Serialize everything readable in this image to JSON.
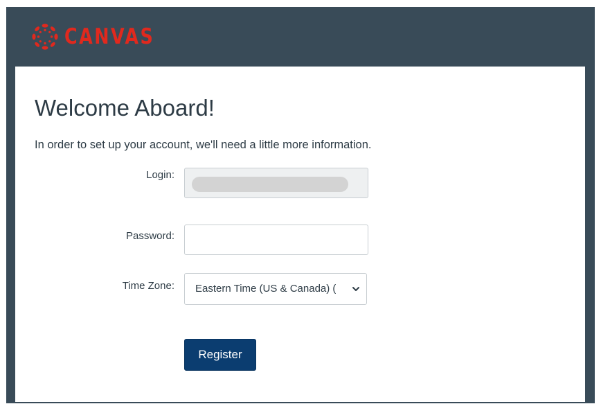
{
  "brand": {
    "name": "CANVAS",
    "logo_icon": "canvas-logo-icon",
    "color": "#e0291e"
  },
  "header": {
    "background": "#394b58"
  },
  "page": {
    "title": "Welcome Aboard!",
    "intro": "In order to set up your account, we'll need a little more information."
  },
  "form": {
    "login": {
      "label": "Login:",
      "value": "",
      "redacted": true
    },
    "password": {
      "label": "Password:",
      "value": ""
    },
    "time_zone": {
      "label": "Time Zone:",
      "selected": "Eastern Time (US & Canada) (",
      "icon": "chevron-down-icon"
    },
    "submit_label": "Register",
    "submit_color": "#0b3d70"
  }
}
